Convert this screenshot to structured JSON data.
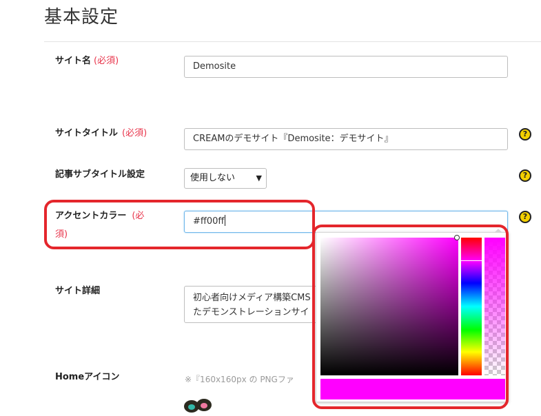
{
  "page": {
    "title": "基本設定"
  },
  "fields": {
    "site_name": {
      "label": "サイト名",
      "required": "(必須)",
      "value": "Demosite"
    },
    "site_title": {
      "label": "サイトタイトル",
      "required": "(必須)",
      "value": "CREAMのデモサイト『Demosite：デモサイト』"
    },
    "subtitle_setting": {
      "label": "記事サブタイトル設定",
      "selected": "使用しない"
    },
    "accent_color": {
      "label": "アクセントカラー",
      "required_line1": "(必",
      "required_line2": "須)",
      "value": "#ff00ff"
    },
    "site_detail": {
      "label": "サイト詳細",
      "line1": "初心者向けメディア構築CMS",
      "line2": "たデモンストレーションサイ"
    },
    "home_icon": {
      "label": "Homeアイコン",
      "note": "※『160x160px の PNGファ"
    }
  },
  "help": {
    "symbol": "?"
  },
  "color_picker": {
    "current_color": "#ff00ff",
    "hue_position": 0.17,
    "saturation": 1.0,
    "brightness": 1.0,
    "alpha": 1.0
  },
  "icons": {
    "help": "question-circle-icon",
    "dropdown": "chevron-down-icon",
    "home_icon_preview": "cream-logo-icon"
  },
  "colors": {
    "required": "#e8334a",
    "help_fill": "#f4d000",
    "highlight": "#e4262c",
    "focus": "#6fb6ea"
  }
}
